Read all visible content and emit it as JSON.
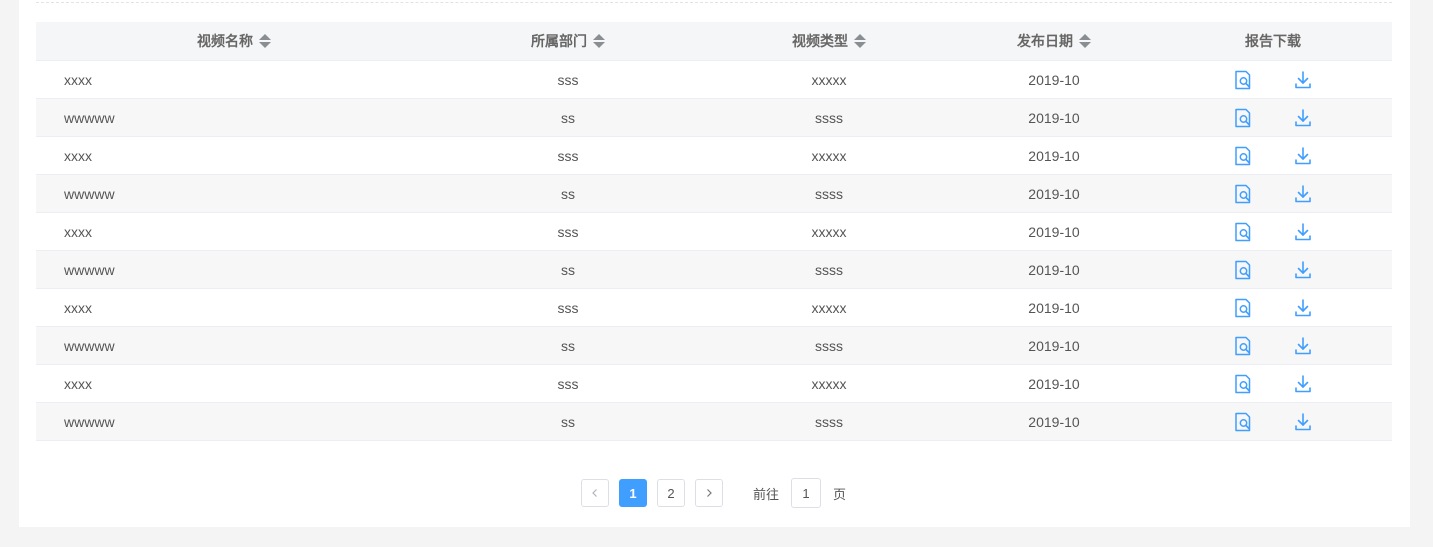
{
  "table": {
    "headers": {
      "name": "视频名称",
      "dept": "所属部门",
      "type": "视频类型",
      "date": "发布日期",
      "report": "报告下载"
    },
    "rows": [
      {
        "name": "xxxx",
        "dept": "sss",
        "type": "xxxxx",
        "date": "2019-10"
      },
      {
        "name": "wwwww",
        "dept": "ss",
        "type": "ssss",
        "date": "2019-10"
      },
      {
        "name": "xxxx",
        "dept": "sss",
        "type": "xxxxx",
        "date": "2019-10"
      },
      {
        "name": "wwwww",
        "dept": "ss",
        "type": "ssss",
        "date": "2019-10"
      },
      {
        "name": "xxxx",
        "dept": "sss",
        "type": "xxxxx",
        "date": "2019-10"
      },
      {
        "name": "wwwww",
        "dept": "ss",
        "type": "ssss",
        "date": "2019-10"
      },
      {
        "name": "xxxx",
        "dept": "sss",
        "type": "xxxxx",
        "date": "2019-10"
      },
      {
        "name": "wwwww",
        "dept": "ss",
        "type": "ssss",
        "date": "2019-10"
      },
      {
        "name": "xxxx",
        "dept": "sss",
        "type": "xxxxx",
        "date": "2019-10"
      },
      {
        "name": "wwwww",
        "dept": "ss",
        "type": "ssss",
        "date": "2019-10"
      }
    ],
    "action_icons": [
      "view-report-icon",
      "download-icon"
    ]
  },
  "pagination": {
    "prev_icon": "chevron-left-icon",
    "next_icon": "chevron-right-icon",
    "pages": [
      "1",
      "2"
    ],
    "current_page": "1",
    "goto_label": "前往",
    "goto_value": "1",
    "goto_suffix": "页"
  },
  "colors": {
    "accent": "#409eff",
    "header_bg": "#f5f6f7",
    "stripe_bg": "#f7f7f7",
    "page_bg": "#f4f4f5"
  }
}
